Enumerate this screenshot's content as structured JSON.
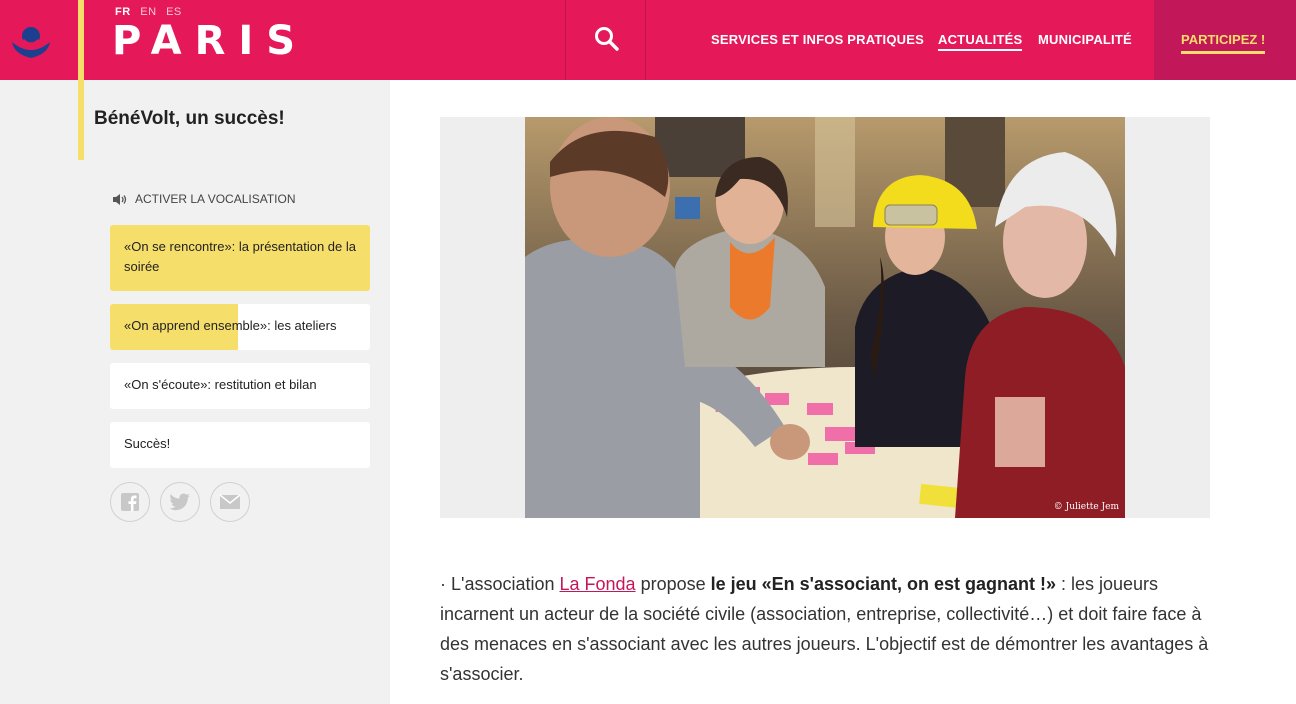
{
  "header": {
    "languages": [
      "FR",
      "EN",
      "ES"
    ],
    "active_language": "FR",
    "brand": "PARIS",
    "nav": [
      "SERVICES ET INFOS PRATIQUES",
      "ACTUALITÉS",
      "MUNICIPALITÉ"
    ],
    "active_nav": "ACTUALITÉS",
    "cta": "PARTICIPEZ !"
  },
  "sidebar": {
    "title": "BénéVolt, un succès!",
    "vocalisation": "ACTIVER LA VOCALISATION",
    "items": [
      {
        "label": "«On se rencontre»: la présentation de la soirée",
        "progress": 1.0
      },
      {
        "label": "«On apprend ensemble»: les ateliers",
        "progress": 0.5
      },
      {
        "label": "«On s'écoute»: restitution et bilan",
        "progress": 0
      },
      {
        "label": "Succès!",
        "progress": 0
      }
    ],
    "social": [
      "facebook-icon",
      "twitter-icon",
      "mail-icon"
    ]
  },
  "main": {
    "photo_credit": "© Juliette Jem",
    "paragraph": {
      "prefix": "· L'association ",
      "link": "La Fonda",
      "mid": " propose ",
      "bold": "le jeu  «En s'associant, on est gagnant !»",
      "rest": " : les joueurs incarnent un acteur de la société civile (association, entreprise, collectivité…) et doit faire face à des menaces en s'associant avec les autres joueurs. L'objectif est de démontrer les avantages à s'associer."
    }
  },
  "colors": {
    "brand_pink": "#e5185a",
    "accent_yellow": "#f6de6b",
    "sidebar_bg": "#f1f1f1"
  }
}
